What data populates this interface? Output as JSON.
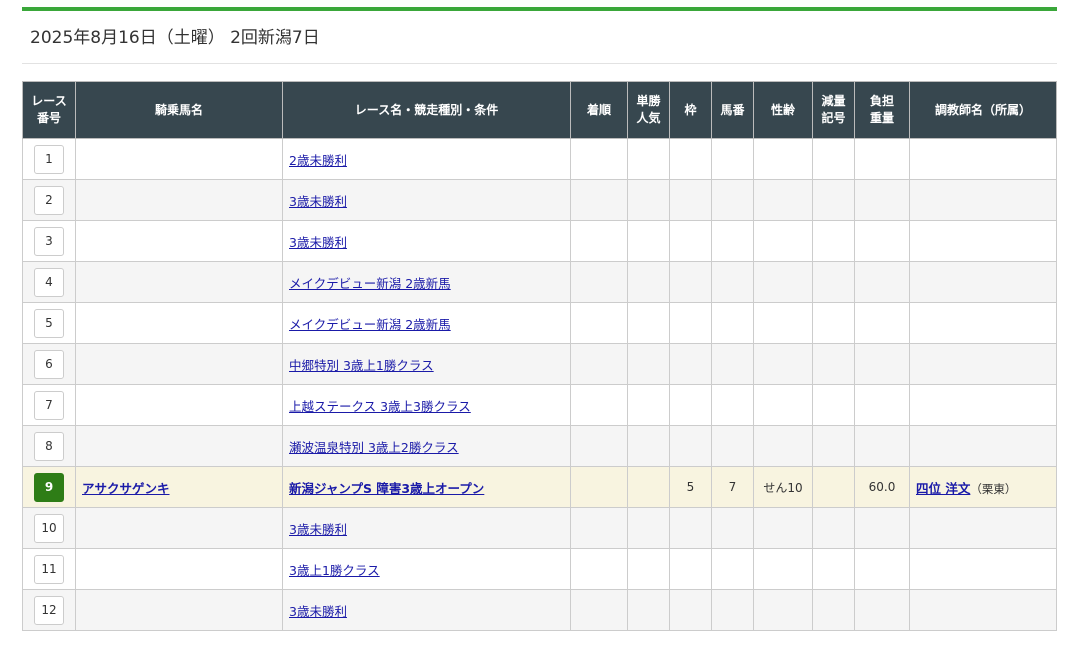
{
  "title": "2025年8月16日（土曜） 2回新潟7日",
  "colors": {
    "accent": "#3aa73a",
    "header_bg": "#37474f",
    "active_race": "#2e7d16",
    "highlight_row": "#f8f4e0"
  },
  "headers": [
    "レース\n番号",
    "騎乗馬名",
    "レース名・競走種別・条件",
    "着順",
    "単勝\n人気",
    "枠",
    "馬番",
    "性齢",
    "減量\n記号",
    "負担\n重量",
    "調教師名（所属）"
  ],
  "rows": [
    {
      "no": "1",
      "horse": "",
      "race": "2歳未勝利",
      "rank": "",
      "pop": "",
      "waku": "",
      "umaban": "",
      "sexage": "",
      "gen": "",
      "weight": "",
      "trainer": "",
      "aff": ""
    },
    {
      "no": "2",
      "horse": "",
      "race": "3歳未勝利",
      "rank": "",
      "pop": "",
      "waku": "",
      "umaban": "",
      "sexage": "",
      "gen": "",
      "weight": "",
      "trainer": "",
      "aff": ""
    },
    {
      "no": "3",
      "horse": "",
      "race": "3歳未勝利",
      "rank": "",
      "pop": "",
      "waku": "",
      "umaban": "",
      "sexage": "",
      "gen": "",
      "weight": "",
      "trainer": "",
      "aff": ""
    },
    {
      "no": "4",
      "horse": "",
      "race": "メイクデビュー新潟 2歳新馬",
      "rank": "",
      "pop": "",
      "waku": "",
      "umaban": "",
      "sexage": "",
      "gen": "",
      "weight": "",
      "trainer": "",
      "aff": ""
    },
    {
      "no": "5",
      "horse": "",
      "race": "メイクデビュー新潟 2歳新馬",
      "rank": "",
      "pop": "",
      "waku": "",
      "umaban": "",
      "sexage": "",
      "gen": "",
      "weight": "",
      "trainer": "",
      "aff": ""
    },
    {
      "no": "6",
      "horse": "",
      "race": "中郷特別 3歳上1勝クラス",
      "rank": "",
      "pop": "",
      "waku": "",
      "umaban": "",
      "sexage": "",
      "gen": "",
      "weight": "",
      "trainer": "",
      "aff": ""
    },
    {
      "no": "7",
      "horse": "",
      "race": "上越ステークス 3歳上3勝クラス",
      "rank": "",
      "pop": "",
      "waku": "",
      "umaban": "",
      "sexage": "",
      "gen": "",
      "weight": "",
      "trainer": "",
      "aff": ""
    },
    {
      "no": "8",
      "horse": "",
      "race": "瀬波温泉特別 3歳上2勝クラス",
      "rank": "",
      "pop": "",
      "waku": "",
      "umaban": "",
      "sexage": "",
      "gen": "",
      "weight": "",
      "trainer": "",
      "aff": ""
    },
    {
      "no": "9",
      "horse": "アサクサゲンキ",
      "race": "新潟ジャンプS 障害3歳上オープン",
      "rank": "",
      "pop": "",
      "waku": "5",
      "umaban": "7",
      "sexage": "せん10",
      "gen": "",
      "weight": "60.0",
      "trainer": "四位 洋文",
      "aff": "（栗東）",
      "active": true
    },
    {
      "no": "10",
      "horse": "",
      "race": "3歳未勝利",
      "rank": "",
      "pop": "",
      "waku": "",
      "umaban": "",
      "sexage": "",
      "gen": "",
      "weight": "",
      "trainer": "",
      "aff": ""
    },
    {
      "no": "11",
      "horse": "",
      "race": "3歳上1勝クラス",
      "rank": "",
      "pop": "",
      "waku": "",
      "umaban": "",
      "sexage": "",
      "gen": "",
      "weight": "",
      "trainer": "",
      "aff": ""
    },
    {
      "no": "12",
      "horse": "",
      "race": "3歳未勝利",
      "rank": "",
      "pop": "",
      "waku": "",
      "umaban": "",
      "sexage": "",
      "gen": "",
      "weight": "",
      "trainer": "",
      "aff": ""
    }
  ]
}
